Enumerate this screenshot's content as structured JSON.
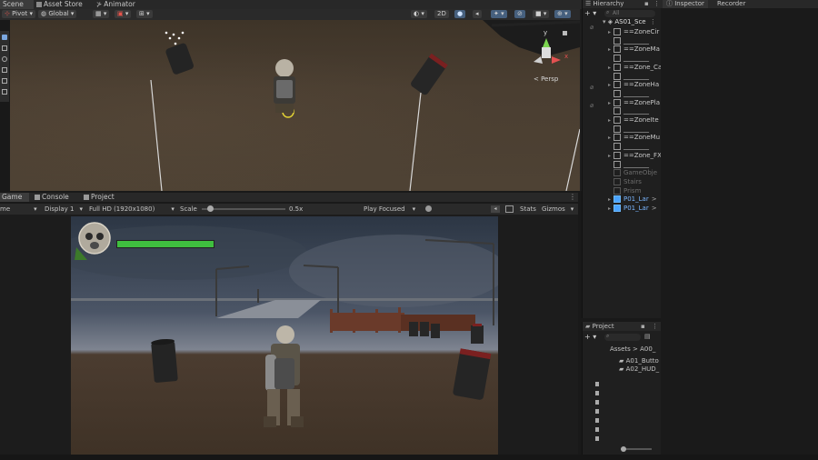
{
  "scene_tabs": [
    {
      "label": "Scene"
    },
    {
      "label": "Asset Store"
    },
    {
      "label": "Animator"
    }
  ],
  "scene_toolbar": {
    "pivot": "Pivot",
    "global": "Global",
    "mode_2d": "2D",
    "persp": "< Persp",
    "gizmo_y": "y",
    "gizmo_x": "x"
  },
  "game_tabs": [
    {
      "label": "Game"
    },
    {
      "label": "Console"
    },
    {
      "label": "Project"
    }
  ],
  "game_toolbar": {
    "mode": "me",
    "display": "Display 1",
    "resolution": "Full HD (1920x1080)",
    "scale_label": "Scale",
    "scale_value": "0.5x",
    "scale_fraction": 0.1,
    "play_focused": "Play Focused",
    "stats": "Stats",
    "gizmos": "Gizmos"
  },
  "hud": {
    "health_fraction": 1.0,
    "health_color": "#3fbf3f"
  },
  "hierarchy": {
    "tab_label": "Hierarchy",
    "search_placeholder": "All",
    "scene_name": "AS01_Sce",
    "items": [
      {
        "label": "==ZoneCir",
        "style": "normal"
      },
      {
        "label": "________",
        "style": "normal"
      },
      {
        "label": "==ZoneMa",
        "style": "normal"
      },
      {
        "label": "________",
        "style": "normal"
      },
      {
        "label": "==Zone_Ca",
        "style": "normal"
      },
      {
        "label": "________",
        "style": "normal"
      },
      {
        "label": "==ZoneHa",
        "style": "normal"
      },
      {
        "label": "________",
        "style": "normal"
      },
      {
        "label": "==ZonePla",
        "style": "normal"
      },
      {
        "label": "________",
        "style": "normal"
      },
      {
        "label": "==ZoneIte",
        "style": "normal"
      },
      {
        "label": "________",
        "style": "normal"
      },
      {
        "label": "==ZoneMu",
        "style": "normal"
      },
      {
        "label": "________",
        "style": "normal"
      },
      {
        "label": "==Zone_FX",
        "style": "normal"
      },
      {
        "label": "________",
        "style": "normal"
      },
      {
        "label": "GameObje",
        "style": "dim"
      },
      {
        "label": "Stairs",
        "style": "dim"
      },
      {
        "label": "Prism",
        "style": "dim"
      },
      {
        "label": "P01_Lar",
        "style": "prefab"
      },
      {
        "label": "P01_Lar",
        "style": "prefab"
      }
    ]
  },
  "inspector": {
    "tab_label": "Inspector",
    "recorder_label": "Recorder"
  },
  "project": {
    "tab_label": "Project",
    "breadcrumb_root": "Assets",
    "breadcrumb_sep": ">",
    "breadcrumb_child": "A00_",
    "folders": [
      {
        "label": "A01_Butto"
      },
      {
        "label": "A02_HUD_"
      }
    ]
  }
}
